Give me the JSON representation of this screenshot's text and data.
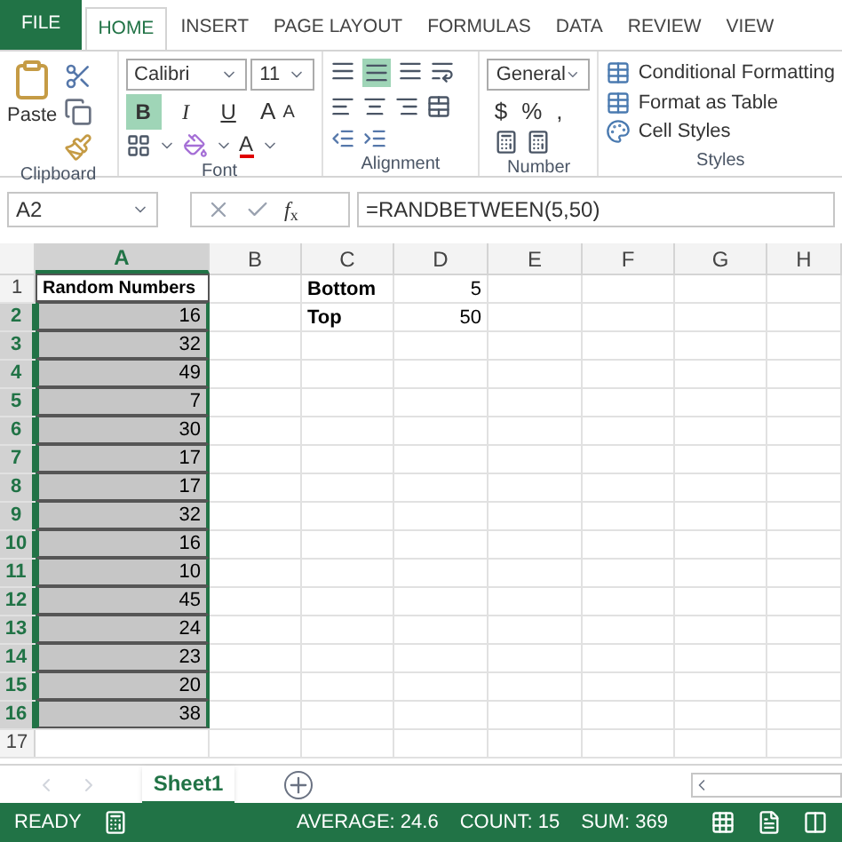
{
  "tabs": [
    {
      "label": "FILE",
      "kind": "file",
      "selected": false
    },
    {
      "label": "HOME",
      "kind": "tab",
      "selected": true
    },
    {
      "label": "INSERT",
      "kind": "tab",
      "selected": false
    },
    {
      "label": "PAGE LAYOUT",
      "kind": "tab",
      "selected": false
    },
    {
      "label": "FORMULAS",
      "kind": "tab",
      "selected": false
    },
    {
      "label": "DATA",
      "kind": "tab",
      "selected": false
    },
    {
      "label": "REVIEW",
      "kind": "tab",
      "selected": false
    },
    {
      "label": "VIEW",
      "kind": "tab",
      "selected": false
    }
  ],
  "ribbon": {
    "clipboard": {
      "label": "Clipboard",
      "paste": "Paste"
    },
    "font": {
      "label": "Font",
      "font_name": "Calibri",
      "font_size": "11",
      "styles": [
        {
          "label": "B",
          "kind": "bold",
          "selected": true
        },
        {
          "label": "I",
          "kind": "italic",
          "selected": false
        },
        {
          "label": "U",
          "kind": "underline",
          "selected": false
        }
      ],
      "grow": "A",
      "shrink": "A",
      "color_letter": "A"
    },
    "alignment": {
      "label": "Alignment",
      "middle_align_selected": true
    },
    "number": {
      "label": "Number",
      "format": "General",
      "symbols": [
        "$",
        "%",
        ","
      ]
    },
    "styles": {
      "label": "Styles",
      "buttons": [
        "Conditional Formatting",
        "Format as Table",
        "Cell Styles"
      ]
    }
  },
  "formula_bar": {
    "name_box": "A2",
    "fx": "*f*$_{x}$",
    "formula": "=RANDBETWEEN(5,50)"
  },
  "columns": [
    {
      "letter": "A",
      "selected": true
    },
    {
      "letter": "B",
      "selected": false
    },
    {
      "letter": "C",
      "selected": false
    },
    {
      "letter": "D",
      "selected": false
    },
    {
      "letter": "E",
      "selected": false
    },
    {
      "letter": "F",
      "selected": false
    },
    {
      "letter": "G",
      "selected": false
    },
    {
      "letter": "H",
      "selected": false
    }
  ],
  "rows": [
    {
      "number": "1",
      "selected": false,
      "kind": "header",
      "col_a": "Random Numbers",
      "col_c": "Bottom",
      "col_d": "5"
    },
    {
      "number": "2",
      "selected": true,
      "kind": "data",
      "col_a": "16",
      "col_c": "Top",
      "col_d": "50"
    },
    {
      "number": "3",
      "selected": true,
      "kind": "data",
      "col_a": "32"
    },
    {
      "number": "4",
      "selected": true,
      "kind": "data",
      "col_a": "49"
    },
    {
      "number": "5",
      "selected": true,
      "kind": "data",
      "col_a": "7"
    },
    {
      "number": "6",
      "selected": true,
      "kind": "data",
      "col_a": "30"
    },
    {
      "number": "7",
      "selected": true,
      "kind": "data",
      "col_a": "17"
    },
    {
      "number": "8",
      "selected": true,
      "kind": "data",
      "col_a": "17"
    },
    {
      "number": "9",
      "selected": true,
      "kind": "data",
      "col_a": "32"
    },
    {
      "number": "10",
      "selected": true,
      "kind": "data",
      "col_a": "16"
    },
    {
      "number": "11",
      "selected": true,
      "kind": "data",
      "col_a": "10"
    },
    {
      "number": "12",
      "selected": true,
      "kind": "data",
      "col_a": "45"
    },
    {
      "number": "13",
      "selected": true,
      "kind": "data",
      "col_a": "24"
    },
    {
      "number": "14",
      "selected": true,
      "kind": "data",
      "col_a": "23"
    },
    {
      "number": "15",
      "selected": true,
      "kind": "data",
      "col_a": "20"
    },
    {
      "number": "16",
      "selected": true,
      "kind": "data",
      "col_a": "38"
    },
    {
      "number": "17",
      "selected": false,
      "kind": "data"
    }
  ],
  "sheets": [
    {
      "name": "Sheet1",
      "selected": true
    }
  ],
  "status_bar": {
    "mode": "READY",
    "stats": [
      "AVERAGE: 24.6",
      "COUNT: 15",
      "SUM: 369"
    ]
  }
}
